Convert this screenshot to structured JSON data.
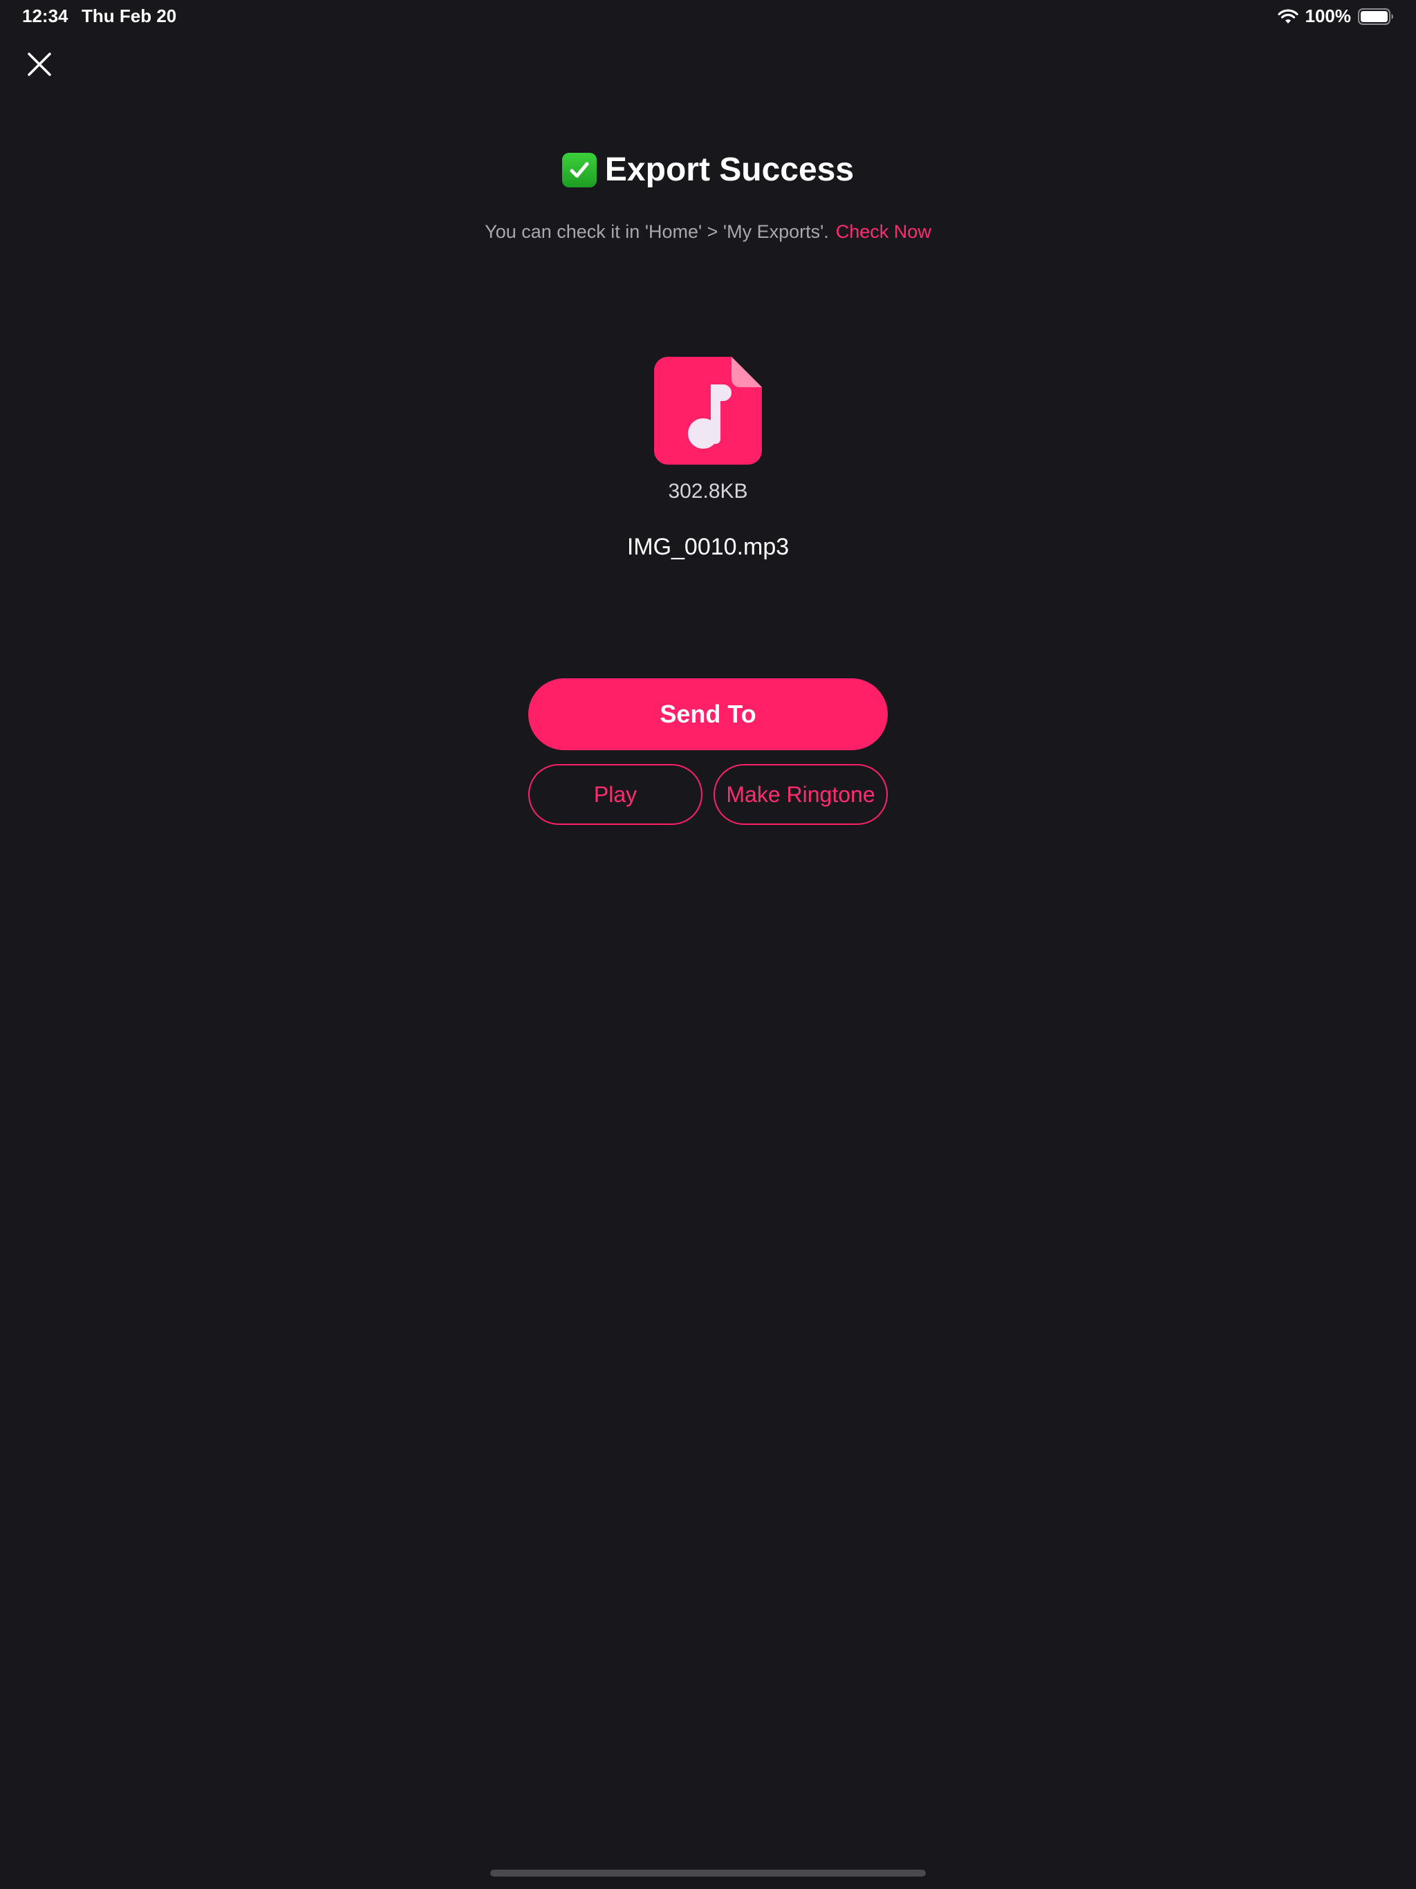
{
  "status_bar": {
    "time": "12:34",
    "date": "Thu Feb 20",
    "battery": "100%"
  },
  "icons": {
    "close": "close-icon",
    "check": "checkmark-icon",
    "file": "music-file-icon",
    "wifi": "wifi-icon",
    "battery": "battery-icon"
  },
  "header": {
    "title": "Export Success",
    "subtitle": "You can check it in 'Home' > 'My Exports'.",
    "link": "Check Now"
  },
  "file": {
    "size": "302.8KB",
    "name": "IMG_0010.mp3"
  },
  "actions": {
    "send": "Send To",
    "play": "Play",
    "ringtone": "Make Ringtone"
  },
  "colors": {
    "background": "#18171c",
    "accent": "#ff2068",
    "success": "#2fbf34"
  }
}
